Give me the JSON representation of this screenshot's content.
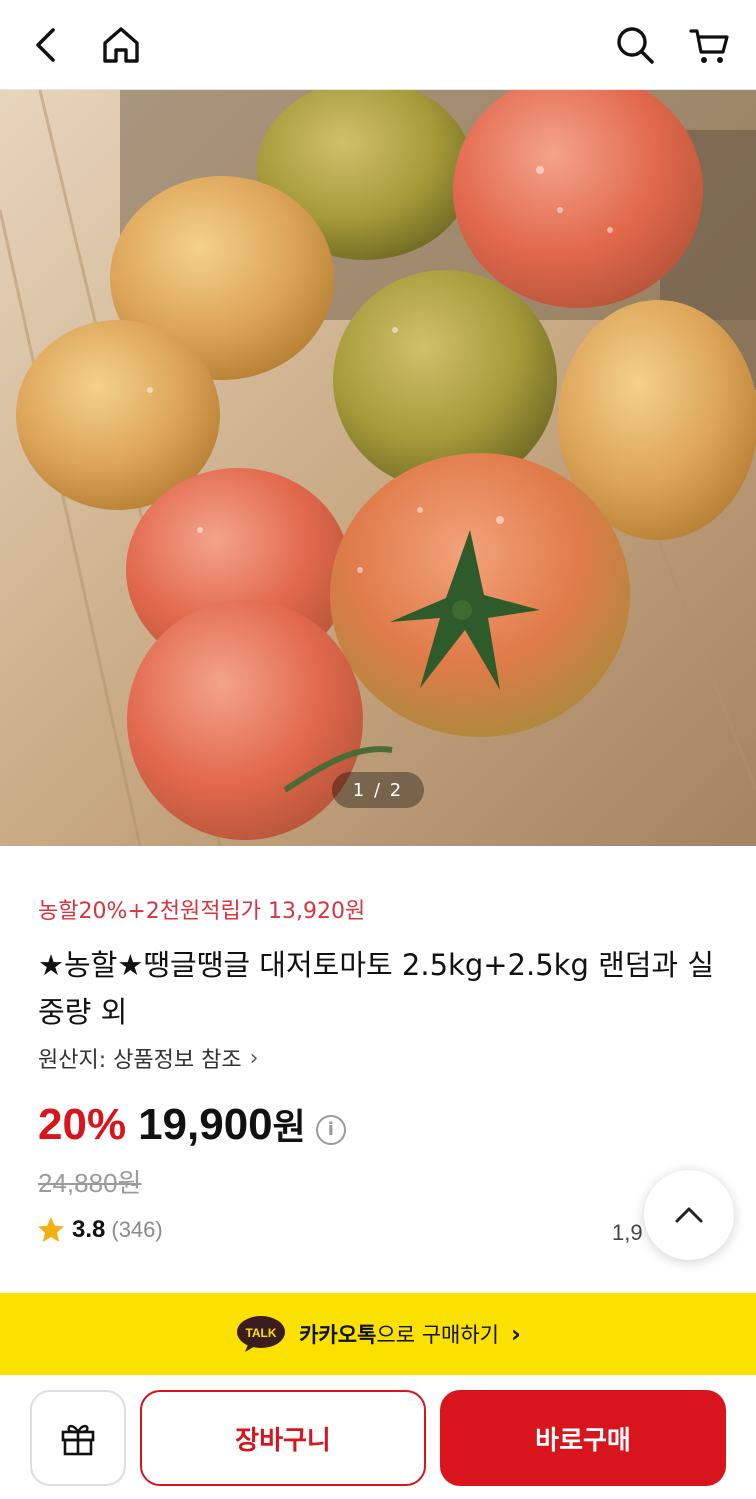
{
  "header": {
    "back_icon": "chevron-left-icon",
    "home_icon": "home-icon",
    "search_icon": "search-icon",
    "cart_icon": "cart-icon"
  },
  "gallery": {
    "pager": "1 / 2",
    "image_subject": "tomatoes-photo"
  },
  "product": {
    "promo": "농할20%+2천원적립가 13,920원",
    "title": "★농할★땡글땡글 대저토마토 2.5kg+2.5kg 랜덤과 실중량 외",
    "origin_label": "원산지: 상품정보 참조",
    "discount": "20%",
    "price": "19,900",
    "price_unit": "원",
    "original_price": "24,880원",
    "rating_score": "3.8",
    "rating_count": "(346)",
    "sold_partial": "1,9"
  },
  "kakao": {
    "badge": "TALK",
    "brand": "카카오톡",
    "text": "으로 구매하기",
    "chevron": "›"
  },
  "bottom_bar": {
    "cart_label": "장바구니",
    "buy_label": "바로구매",
    "gift_icon": "gift-icon"
  },
  "colors": {
    "accent_red": "#d8141c",
    "promo_red": "#d9343f",
    "kakao_yellow": "#fae100"
  }
}
